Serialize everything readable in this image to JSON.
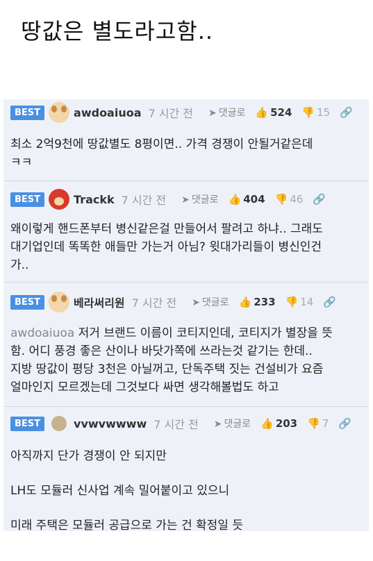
{
  "page_title": "땅값은 별도라고함..",
  "ui": {
    "reply_label": "댓글로",
    "best_label": "BEST"
  },
  "comments": [
    {
      "user": "awdoaiuoa",
      "time": "7 시간 전",
      "likes": "524",
      "dislikes": "15",
      "text_lines": [
        "최소 2억9천에 땅값별도 8평이면.. 가격 경쟁이 안될거같은데",
        "ㅋㅋ"
      ]
    },
    {
      "user": "Trackk",
      "time": "7 시간 전",
      "likes": "404",
      "dislikes": "46",
      "text_lines": [
        "왜이렇게 핸드폰부터 병신같은걸 만들어서 팔려고 하냐.. 그래도",
        "대기업인데 똑똑한 애들만 가는거 아님? 윗대가리들이 병신인건",
        "가.."
      ]
    },
    {
      "user": "베라써리원",
      "time": "7 시간 전",
      "likes": "233",
      "dislikes": "14",
      "mention": "awdoaiuoa",
      "text_first": " 저거 브랜드 이름이 코티지인데, 코티지가 별장을 뜻",
      "text_lines": [
        "함. 어디 풍경 좋은 산이나 바닷가쪽에 쓰라는것 같기는 한데..",
        "지방 땅값이 평당 3천은 아닐꺼고, 단독주택 짓는 건설비가 요즘",
        "얼마인지 모르겠는데 그것보다 싸면 생각해볼법도 하고"
      ]
    },
    {
      "user": "vvwvwwww",
      "time": "7 시간 전",
      "likes": "203",
      "dislikes": "7",
      "paragraphs": [
        "아직까지 단가 경쟁이 안 되지만",
        "LH도 모듈러 신사업 계속 밀어붙이고 있으니",
        "미래 주택은 모듈러 공급으로 가는 건 확정일 듯"
      ]
    }
  ]
}
